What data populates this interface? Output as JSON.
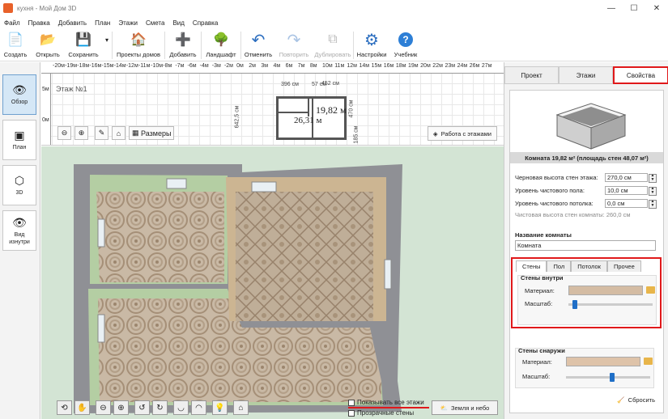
{
  "window": {
    "title": "кухня - Мой Дом 3D",
    "min": "—",
    "max": "☐",
    "close": "✕"
  },
  "menu": [
    "Файл",
    "Правка",
    "Добавить",
    "План",
    "Этажи",
    "Смета",
    "Вид",
    "Справка"
  ],
  "toolbar": [
    {
      "label": "Создать",
      "icon": "📄",
      "name": "create-button",
      "disabled": false
    },
    {
      "label": "Открыть",
      "icon": "📂",
      "name": "open-button",
      "disabled": false
    },
    {
      "label": "Сохранить",
      "icon": "💾",
      "name": "save-button",
      "disabled": false
    },
    {
      "label": "Проекты домов",
      "icon": "🏠",
      "name": "house-projects-button",
      "disabled": false
    },
    {
      "label": "Добавить",
      "icon": "➕",
      "name": "add-button",
      "disabled": false
    },
    {
      "label": "Ландшафт",
      "icon": "🌳",
      "name": "landscape-button",
      "disabled": false
    },
    {
      "label": "Отменить",
      "icon": "↶",
      "name": "undo-button",
      "disabled": false
    },
    {
      "label": "Повторить",
      "icon": "↷",
      "name": "redo-button",
      "disabled": true
    },
    {
      "label": "Дублировать",
      "icon": "⧉",
      "name": "duplicate-button",
      "disabled": true
    },
    {
      "label": "Настройки",
      "icon": "⚙",
      "name": "settings-button",
      "disabled": false
    },
    {
      "label": "Учебник",
      "icon": "?",
      "name": "tutorial-button",
      "disabled": false
    }
  ],
  "sidebar": [
    {
      "label": "Обзор",
      "icon": "👁",
      "active": true
    },
    {
      "label": "План",
      "icon": "▣",
      "active": false
    },
    {
      "label": "3D",
      "icon": "⬡",
      "active": false
    },
    {
      "label": "Вид изнутри",
      "icon": "👁",
      "active": false
    }
  ],
  "plan": {
    "floor_label": "Этаж №1",
    "ruler": [
      "-20м",
      "-19м",
      "-18м",
      "-16м",
      "-15м",
      "-14м",
      "-12м",
      "-11м",
      "-10м",
      "-8м",
      "-7м",
      "-6м",
      "-4м",
      "-3м",
      "-2м",
      "0м",
      "2м",
      "3м",
      "4м",
      "6м",
      "7м",
      "8м",
      "10м",
      "11м",
      "12м",
      "14м",
      "15м",
      "16м",
      "18м",
      "19м",
      "20м",
      "22м",
      "23м",
      "24м",
      "26м",
      "27м"
    ],
    "ruler_left": [
      "5м",
      "0м"
    ],
    "dim_top": "396 см",
    "dim_top2": "57 см",
    "dim_top3": "452 см",
    "dim_left": "642,5 см",
    "dim_right": "470 см",
    "dim_right2": "185 см",
    "area_big": "19,82 м",
    "area_small": "26,31 м",
    "sizes_button": "Размеры",
    "floors_button": "Работа с этажами"
  },
  "view3d": {
    "show_all_floors": "Показывать все этажи",
    "transparent_walls": "Прозрачные стены",
    "sky_button": "Земля и небо"
  },
  "panel": {
    "tabs": [
      "Проект",
      "Этажи",
      "Свойства"
    ],
    "active_tab": 2,
    "room_caption": "Комната 19,82 м²  (площадь стен 48,07 м²)",
    "fields": [
      {
        "label": "Черновая высота стен этажа:",
        "value": "270,0 см"
      },
      {
        "label": "Уровень чистового пола:",
        "value": "10,0 см"
      },
      {
        "label": "Уровень чистового потолка:",
        "value": "0,0 см"
      }
    ],
    "note": "Чистовая высота стен комнаты: 260,0 см",
    "name_title": "Название комнаты",
    "name_value": "Комната",
    "subtabs": [
      "Стены",
      "Пол",
      "Потолок",
      "Прочее"
    ],
    "inner_title": "Стены внутри",
    "outer_title": "Стены снаружи",
    "material_label": "Материал:",
    "scale_label": "Масштаб:",
    "inner_scale": 0.05,
    "outer_scale": 0.55,
    "reset": "Сбросить"
  },
  "colors": {
    "accent": "#e0191b",
    "floor_green": "#d3e4d4",
    "active_blue": "#d5e7f6"
  }
}
